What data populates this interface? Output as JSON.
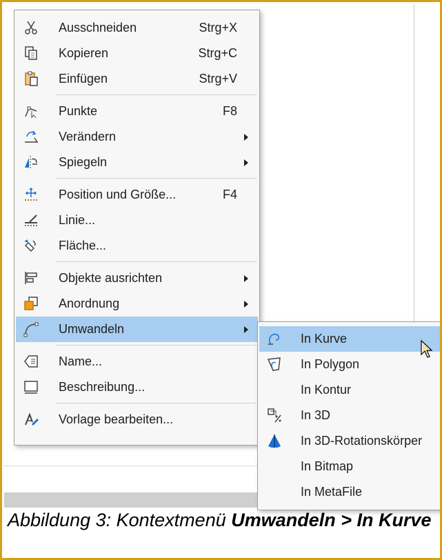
{
  "main_menu": [
    {
      "id": "cut",
      "label": "Ausschneiden",
      "shortcut": "Strg+X",
      "icon": "scissors-icon",
      "submenu": false
    },
    {
      "id": "copy",
      "label": "Kopieren",
      "shortcut": "Strg+C",
      "icon": "copy-icon",
      "submenu": false
    },
    {
      "id": "paste",
      "label": "Einfügen",
      "shortcut": "Strg+V",
      "icon": "paste-icon",
      "submenu": false
    },
    {
      "id": "points",
      "label": "Punkte",
      "shortcut": "F8",
      "icon": "points-icon",
      "submenu": false
    },
    {
      "id": "transform",
      "label": "Verändern",
      "shortcut": "",
      "icon": "transform-icon",
      "submenu": true
    },
    {
      "id": "mirror",
      "label": "Spiegeln",
      "shortcut": "",
      "icon": "mirror-icon",
      "submenu": true
    },
    {
      "id": "position-size",
      "label": "Position und Größe...",
      "shortcut": "F4",
      "icon": "position-size-icon",
      "submenu": false
    },
    {
      "id": "line",
      "label": "Linie...",
      "shortcut": "",
      "icon": "line-icon",
      "submenu": false
    },
    {
      "id": "area",
      "label": "Fläche...",
      "shortcut": "",
      "icon": "area-fill-icon",
      "submenu": false
    },
    {
      "id": "align",
      "label": "Objekte ausrichten",
      "shortcut": "",
      "icon": "align-icon",
      "submenu": true
    },
    {
      "id": "arrange",
      "label": "Anordnung",
      "shortcut": "",
      "icon": "arrange-icon",
      "submenu": true
    },
    {
      "id": "convert",
      "label": "Umwandeln",
      "shortcut": "",
      "icon": "convert-icon",
      "submenu": true,
      "highlighted": true
    },
    {
      "id": "name",
      "label": "Name...",
      "shortcut": "",
      "icon": "name-icon",
      "submenu": false
    },
    {
      "id": "description",
      "label": "Beschreibung...",
      "shortcut": "",
      "icon": "description-icon",
      "submenu": false
    },
    {
      "id": "edit-style",
      "label": "Vorlage bearbeiten...",
      "shortcut": "",
      "icon": "edit-style-icon",
      "submenu": false
    }
  ],
  "sub_menu": [
    {
      "id": "to-curve",
      "label": "In Kurve",
      "icon": "curve-icon",
      "highlighted": true
    },
    {
      "id": "to-polygon",
      "label": "In Polygon",
      "icon": "polygon-icon"
    },
    {
      "id": "to-contour",
      "label": "In Kontur",
      "icon": ""
    },
    {
      "id": "to-3d",
      "label": "In 3D",
      "icon": "3d-icon"
    },
    {
      "id": "to-3d-rotation",
      "label": "In 3D-Rotationskörper",
      "icon": "rotation-body-icon"
    },
    {
      "id": "to-bitmap",
      "label": "In Bitmap",
      "icon": ""
    },
    {
      "id": "to-metafile",
      "label": "In MetaFile",
      "icon": ""
    }
  ],
  "caption": {
    "prefix": "Abbildung 3: Kontextmenü ",
    "bold": "Umwandeln > In Kurve"
  },
  "colors": {
    "highlight": "#a7cdf0",
    "frame_border": "#d4a017",
    "menu_bg": "#f7f7f7"
  }
}
